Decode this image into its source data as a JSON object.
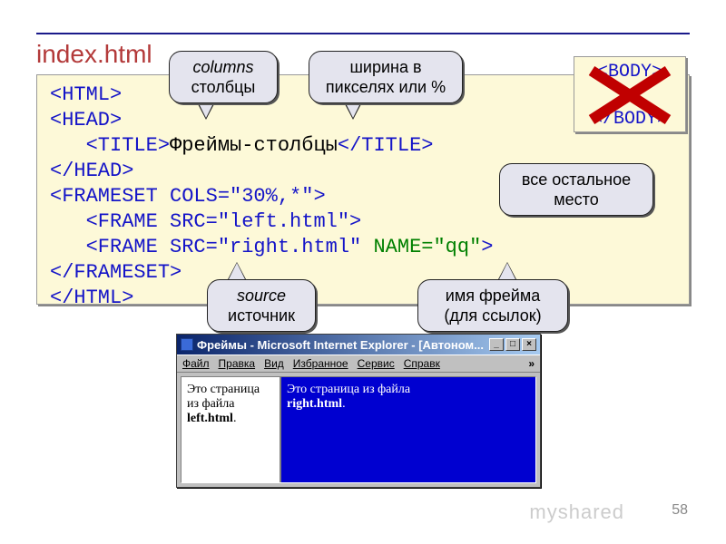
{
  "page": {
    "title_file": "index.html",
    "page_number": "58",
    "watermark": "myshared"
  },
  "code": {
    "l1": "<HTML>",
    "l2": "<HEAD>",
    "l3_pre": "   <TITLE>",
    "l3_txt": "Фреймы-столбцы",
    "l3_post": "</TITLE>",
    "l4": "</HEAD>",
    "l5": "<FRAMESET COLS=\"30%,*\">",
    "l6": "   <FRAME SRC=\"left.html\">",
    "l7a": "   <FRAME SRC=\"right.html\" ",
    "l7b": "NAME=\"qq\"",
    "l7c": ">",
    "l8": "</FRAMESET>",
    "l9": "</HTML>"
  },
  "body_box": {
    "open": "<BODY>",
    "dots": "...",
    "close": "</BODY>"
  },
  "callouts": {
    "columns_en": "columns",
    "columns_ru": "столбцы",
    "width": "ширина в пикселях или %",
    "rest": "все остальное место",
    "source_en": "source",
    "source_ru": "источник",
    "frame_name": "имя фрейма (для ссылок)"
  },
  "ie": {
    "title": "Фреймы - Microsoft Internet Explorer - [Автоном...",
    "menu": {
      "file": "Файл",
      "edit": "Правка",
      "view": "Вид",
      "fav": "Избранное",
      "tools": "Сервис",
      "help": "Справк",
      "chev": "»"
    },
    "left_text": "Это страница из файла",
    "left_bold": "left.html",
    "right_text": "Это страница из файла",
    "right_bold": "right.html",
    "dot": "."
  }
}
